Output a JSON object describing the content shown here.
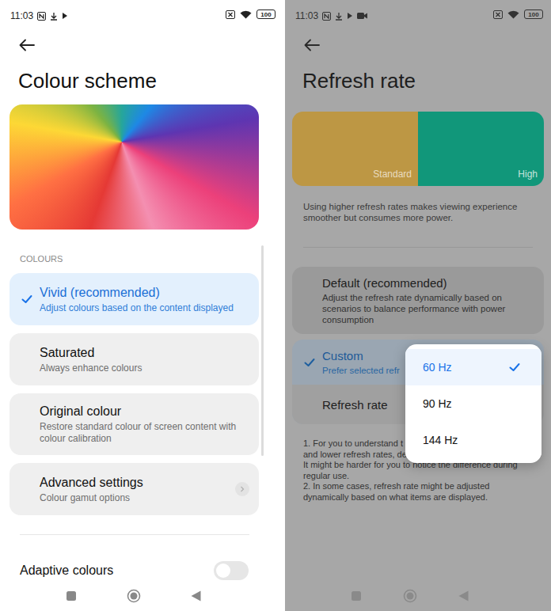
{
  "left": {
    "status_bar": {
      "time": "11:03",
      "battery": "100"
    },
    "title": "Colour scheme",
    "section": "COLOURS",
    "options": [
      {
        "kind": "option",
        "title": "Vivid (recommended)",
        "subtitle": "Adjust colours based on the content displayed",
        "selected": true
      },
      {
        "kind": "option",
        "title": "Saturated",
        "subtitle": "Always enhance colours",
        "selected": false
      },
      {
        "kind": "option",
        "title": "Original colour",
        "subtitle": "Restore standard colour of screen content with colour calibration",
        "selected": false
      },
      {
        "kind": "link",
        "title": "Advanced settings",
        "subtitle": "Colour gamut options",
        "selected": false
      }
    ],
    "adaptive": {
      "label": "Adaptive colours",
      "on": false
    }
  },
  "right": {
    "status_bar": {
      "time": "11:03",
      "battery": "100"
    },
    "title": "Refresh rate",
    "preview": {
      "standard": "Standard",
      "high": "High"
    },
    "description": "Using higher refresh rates makes viewing experience smoother but consumes more power.",
    "modes": [
      {
        "title": "Default (recommended)",
        "subtitle": "Adjust the refresh rate dynamically based on scenarios to balance performance with power consumption",
        "selected": false
      },
      {
        "title": "Custom",
        "subtitle": "Prefer selected refr",
        "selected": true
      }
    ],
    "refresh_row": "Refresh rate",
    "notes": [
      "1. For you to understand t",
      "and lower refresh rates, demos are played slower here.",
      "It might be harder for you to notice the difference during",
      "regular use.",
      "2. In some cases, refresh rate might be adjusted",
      "dynamically based on what items are displayed."
    ],
    "menu": [
      {
        "label": "60 Hz",
        "selected": true
      },
      {
        "label": "90 Hz",
        "selected": false
      },
      {
        "label": "144 Hz",
        "selected": false
      }
    ]
  }
}
